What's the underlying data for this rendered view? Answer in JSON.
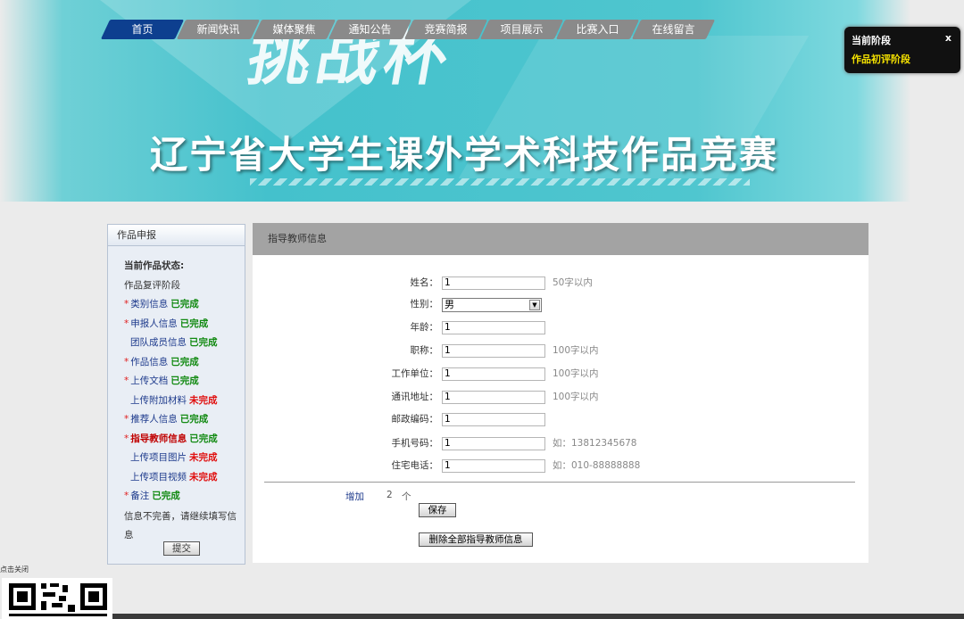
{
  "banner": {
    "title": "辽宁省大学生课外学术科技作品竞赛",
    "deco_text": "挑战杯"
  },
  "nav": {
    "tabs": [
      "首页",
      "新闻快讯",
      "媒体聚焦",
      "通知公告",
      "竞赛简报",
      "项目展示",
      "比赛入口",
      "在线留言"
    ],
    "active_index": 0
  },
  "stage_popup": {
    "title": "当前阶段",
    "value": "作品初评阶段",
    "close": "x"
  },
  "sidebar": {
    "header": "作品申报",
    "status_title": "当前作品状态:",
    "status_value": "作品复评阶段",
    "items": [
      {
        "label": "类别信息",
        "status": "已完成",
        "required": true
      },
      {
        "label": "申报人信息",
        "status": "已完成",
        "required": true
      },
      {
        "label": "团队成员信息",
        "status": "已完成",
        "required": false
      },
      {
        "label": "作品信息",
        "status": "已完成",
        "required": true
      },
      {
        "label": "上传文档",
        "status": "已完成",
        "required": true
      },
      {
        "label": "上传附加材料",
        "status": "未完成",
        "required": false
      },
      {
        "label": "推荐人信息",
        "status": "已完成",
        "required": true
      },
      {
        "label": "指导教师信息",
        "status": "已完成",
        "required": true,
        "current": true
      },
      {
        "label": "上传项目图片",
        "status": "未完成",
        "required": false
      },
      {
        "label": "上传项目视频",
        "status": "未完成",
        "required": false
      },
      {
        "label": "备注",
        "status": "已完成",
        "required": true
      }
    ],
    "note": "信息不完善，请继续填写信息",
    "submit_label": "提交"
  },
  "main": {
    "header": "指导教师信息",
    "fields": [
      {
        "label": "姓名：",
        "value": "1",
        "hint": "50字以内",
        "type": "text"
      },
      {
        "label": "性别：",
        "value": "男",
        "hint": "",
        "type": "select"
      },
      {
        "label": "年龄：",
        "value": "1",
        "hint": "",
        "type": "text"
      },
      {
        "label": "职称：",
        "value": "1",
        "hint": "100字以内",
        "type": "text"
      },
      {
        "label": "工作单位：",
        "value": "1",
        "hint": "100字以内",
        "type": "text"
      },
      {
        "label": "通讯地址：",
        "value": "1",
        "hint": "100字以内",
        "type": "text"
      },
      {
        "label": "邮政编码：",
        "value": "1",
        "hint": "",
        "type": "text"
      },
      {
        "label": "手机号码：",
        "value": "1",
        "hint": "如：13812345678",
        "type": "text"
      },
      {
        "label": "住宅电话：",
        "value": "1",
        "hint": "如：010-88888888",
        "type": "text"
      }
    ],
    "add_label": "增加",
    "count": "2",
    "count_unit": "个",
    "save_label": "保存",
    "delete_all_label": "删除全部指导教师信息"
  },
  "footer": {
    "close_text": "点击关闭"
  },
  "colors": {
    "banner_teal": "#44c1cc",
    "nav_active": "#0d3f8f",
    "nav_inactive": "#8a8a8a",
    "done": "#128a12",
    "todo": "#e01010",
    "stage_highlight": "#f4e100"
  }
}
